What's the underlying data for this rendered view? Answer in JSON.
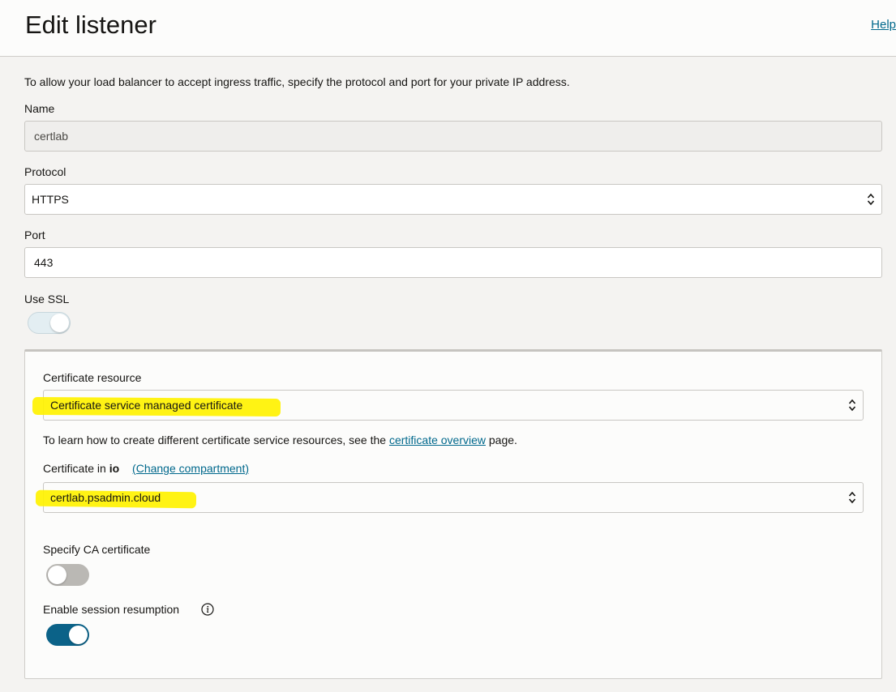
{
  "header": {
    "title": "Edit listener",
    "help_label": "Help"
  },
  "intro_text": "To allow your load balancer to accept ingress traffic, specify the protocol and port for your private IP address.",
  "name": {
    "label": "Name",
    "value": "certlab"
  },
  "protocol": {
    "label": "Protocol",
    "value": "HTTPS"
  },
  "port": {
    "label": "Port",
    "value": "443"
  },
  "use_ssl": {
    "label": "Use SSL",
    "enabled": true
  },
  "ssl_panel": {
    "certificate_resource": {
      "label": "Certificate resource",
      "value": "Certificate service managed certificate"
    },
    "learn_text_before": "To learn how to create different certificate service resources, see the",
    "learn_link": "certificate overview",
    "learn_text_after": "page.",
    "certificate_in": {
      "label_prefix": "Certificate in",
      "compartment": "io",
      "change_link": "(Change compartment)",
      "value": "certlab.psadmin.cloud"
    },
    "specify_ca": {
      "label": "Specify CA certificate",
      "enabled": false
    },
    "session_resumption": {
      "label": "Enable session resumption",
      "enabled": true
    }
  },
  "colors": {
    "accent": "#00688c",
    "toggle_on": "#0b6288",
    "toggle_off": "#bab8b4",
    "toggle_ssl": "#e3eef2",
    "highlight": "#fff200"
  },
  "icons": {
    "select": "chevron-up-down-icon",
    "info": "info-icon"
  }
}
